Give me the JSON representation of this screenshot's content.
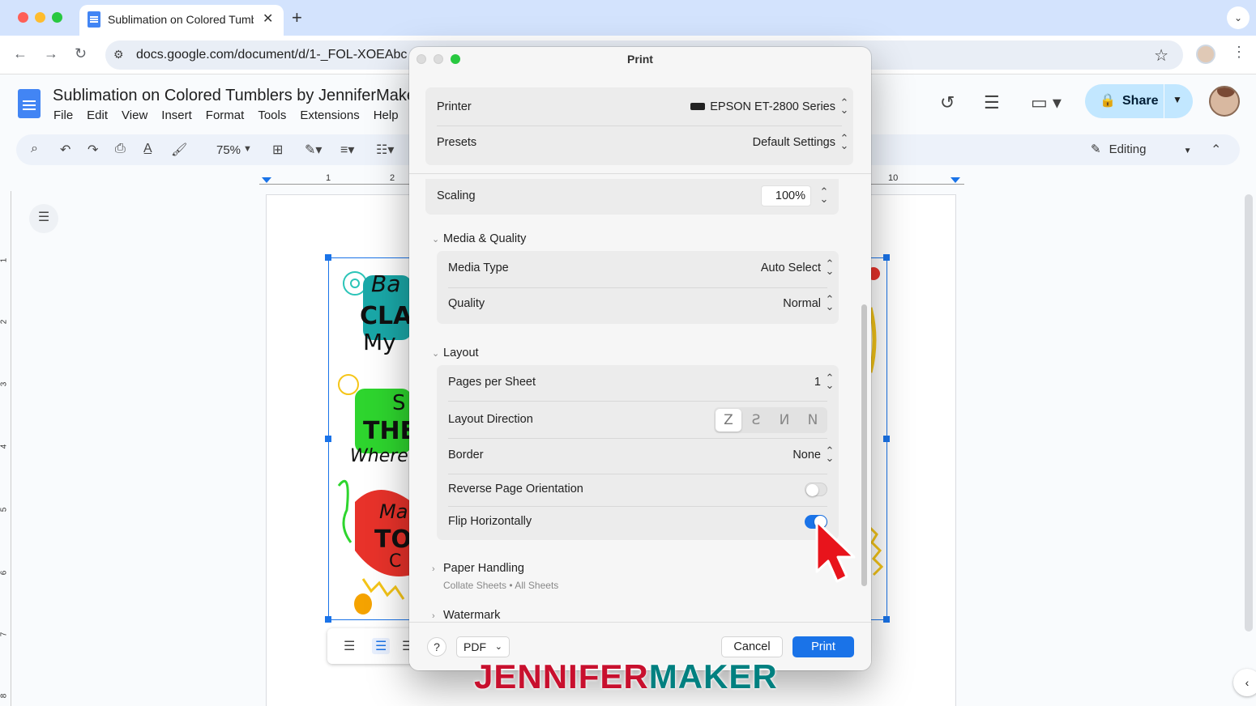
{
  "browser": {
    "tab_title": "Sublimation on Colored Tumb",
    "close_glyph": "✕",
    "new_tab_glyph": "+",
    "dropdown_glyph": "⌄",
    "url": "docs.google.com/document/d/1-_FOL-XOEAbc",
    "traffic_colors": [
      "#ff5f57",
      "#febc2e",
      "#28c840"
    ]
  },
  "docs": {
    "title": "Sublimation on Colored Tumblers by JenniferMaker",
    "menu": [
      "File",
      "Edit",
      "View",
      "Insert",
      "Format",
      "Tools",
      "Extensions",
      "Help"
    ],
    "share_label": "Share",
    "zoom": "75%",
    "mode": "Editing",
    "ruler_numbers": [
      "1",
      "2",
      "10"
    ],
    "vruler_numbers": [
      "1",
      "2",
      "3",
      "4",
      "5",
      "6",
      "7",
      "8"
    ]
  },
  "print_dialog": {
    "title": "Print",
    "printer": {
      "label": "Printer",
      "value": "EPSON ET-2800 Series"
    },
    "presets": {
      "label": "Presets",
      "value": "Default Settings"
    },
    "scaling": {
      "label": "Scaling",
      "value": "100%"
    },
    "media_quality": {
      "heading": "Media & Quality",
      "media_type": {
        "label": "Media Type",
        "value": "Auto Select"
      },
      "quality": {
        "label": "Quality",
        "value": "Normal"
      }
    },
    "layout": {
      "heading": "Layout",
      "pages_per_sheet": {
        "label": "Pages per Sheet",
        "value": "1"
      },
      "layout_direction": {
        "label": "Layout Direction",
        "options": [
          "Z",
          "Ƨ",
          "И",
          "N"
        ],
        "selected": 0
      },
      "border": {
        "label": "Border",
        "value": "None"
      },
      "reverse_orientation": {
        "label": "Reverse Page Orientation",
        "on": false
      },
      "flip_horizontally": {
        "label": "Flip Horizontally",
        "on": true
      }
    },
    "paper_handling": {
      "heading": "Paper Handling",
      "subtitle": "Collate Sheets • All Sheets"
    },
    "watermark": {
      "heading": "Watermark"
    },
    "help_label": "?",
    "pdf_label": "PDF",
    "cancel_label": "Cancel",
    "print_label": "Print"
  },
  "branding": {
    "part1": "JENNIFER",
    "part2": "MAKER"
  },
  "colors": {
    "accent": "#1a73e8",
    "share_bg": "#c2e7ff",
    "brand_red": "#c8102e",
    "brand_teal": "#008080"
  }
}
